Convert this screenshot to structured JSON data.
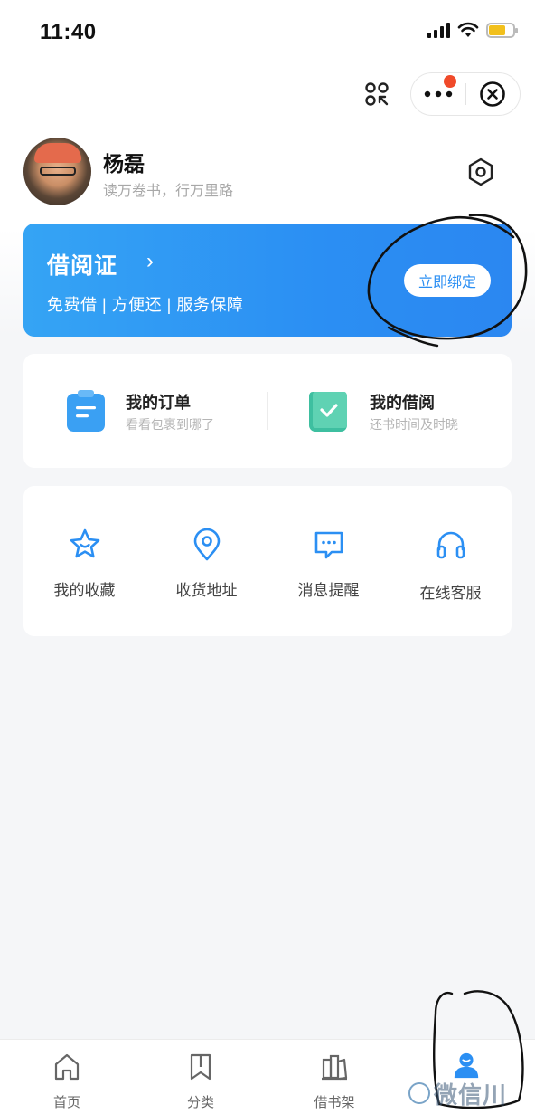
{
  "status_bar": {
    "time": "11:40"
  },
  "top_bar": {
    "scan_icon": "scan-icon",
    "more_icon": "more-dots-icon",
    "close_icon": "close-circle-icon"
  },
  "profile": {
    "name": "杨磊",
    "motto": "读万卷书，行万里路"
  },
  "library_card": {
    "title": "借阅证",
    "arrow": "›",
    "subtitle": "免费借 | 方便还 | 服务保障",
    "bind_label": "立即绑定"
  },
  "orders": [
    {
      "title": "我的订单",
      "subtitle": "看看包裹到哪了",
      "icon": "order-list-icon",
      "color": "#3aa0f3"
    },
    {
      "title": "我的借阅",
      "subtitle": "还书时间及时晓",
      "icon": "borrow-check-icon",
      "color": "#3ebfa0"
    }
  ],
  "actions": [
    {
      "label": "我的收藏",
      "icon": "star-icon"
    },
    {
      "label": "收货地址",
      "icon": "location-pin-icon"
    },
    {
      "label": "消息提醒",
      "icon": "message-icon"
    },
    {
      "label": "在线客服",
      "icon": "headset-icon"
    }
  ],
  "tabbar": [
    {
      "label": "首页",
      "icon": "home-icon"
    },
    {
      "label": "分类",
      "icon": "bookmark-icon"
    },
    {
      "label": "借书架",
      "icon": "bookshelf-icon"
    },
    {
      "label": "",
      "icon": "profile-person-icon",
      "active": true
    }
  ],
  "colors": {
    "accent": "#2b8ff3",
    "banner_start": "#35a4f4",
    "badge_red": "#f04a2a",
    "background": "#f5f6f8"
  },
  "watermark": {
    "text": "微信川"
  }
}
